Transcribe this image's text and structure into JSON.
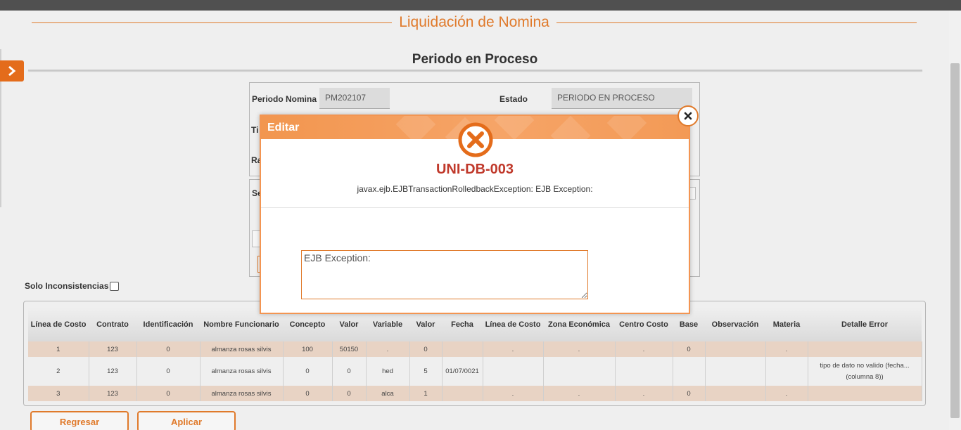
{
  "page": {
    "title": "Liquidación de Nomina",
    "section_title": "Periodo en Proceso"
  },
  "form": {
    "periodo_label": "Periodo Nomina",
    "periodo_value": "PM202107",
    "estado_label": "Estado",
    "estado_value": "PERIODO EN PROCESO",
    "peek_tipo": "Ti",
    "peek_ra": "Ra",
    "peek_se": "Se"
  },
  "filter": {
    "solo_label": "Solo Inconsistencias"
  },
  "table": {
    "headers": [
      "Línea de Costo",
      "Contrato",
      "Identificación",
      "Nombre Funcionario",
      "Concepto",
      "Valor",
      "Variable",
      "Valor",
      "Fecha",
      "Línea de Costo",
      "Zona Económica",
      "Centro Costo",
      "Base",
      "Observación",
      "Materia",
      "Detalle Error"
    ],
    "rows": [
      [
        "1",
        "123",
        "0",
        "almanza rosas silvis",
        "100",
        "50150",
        ".",
        "0",
        "",
        ".",
        ".",
        ".",
        "0",
        "",
        ".",
        ""
      ],
      [
        "2",
        "123",
        "0",
        "almanza rosas silvis",
        "0",
        "0",
        "hed",
        "5",
        "01/07/0021",
        "",
        "",
        "",
        "",
        "",
        "",
        "tipo de dato no valido (fecha... (columna 8))"
      ],
      [
        "3",
        "123",
        "0",
        "almanza rosas silvis",
        "0",
        "0",
        "alca",
        "1",
        "",
        ".",
        ".",
        ".",
        "0",
        "",
        ".",
        ""
      ]
    ]
  },
  "buttons": {
    "regresar": "Regresar",
    "aplicar": "Aplicar"
  },
  "modal": {
    "title": "Editar",
    "error_code": "UNI-DB-003",
    "error_message": "javax.ejb.EJBTransactionRolledbackException: EJB Exception:",
    "error_detail": "EJB Exception:"
  },
  "colors": {
    "accent": "#e07a2b",
    "error": "#c0392b",
    "row_highlight": "#e8d3c4"
  }
}
